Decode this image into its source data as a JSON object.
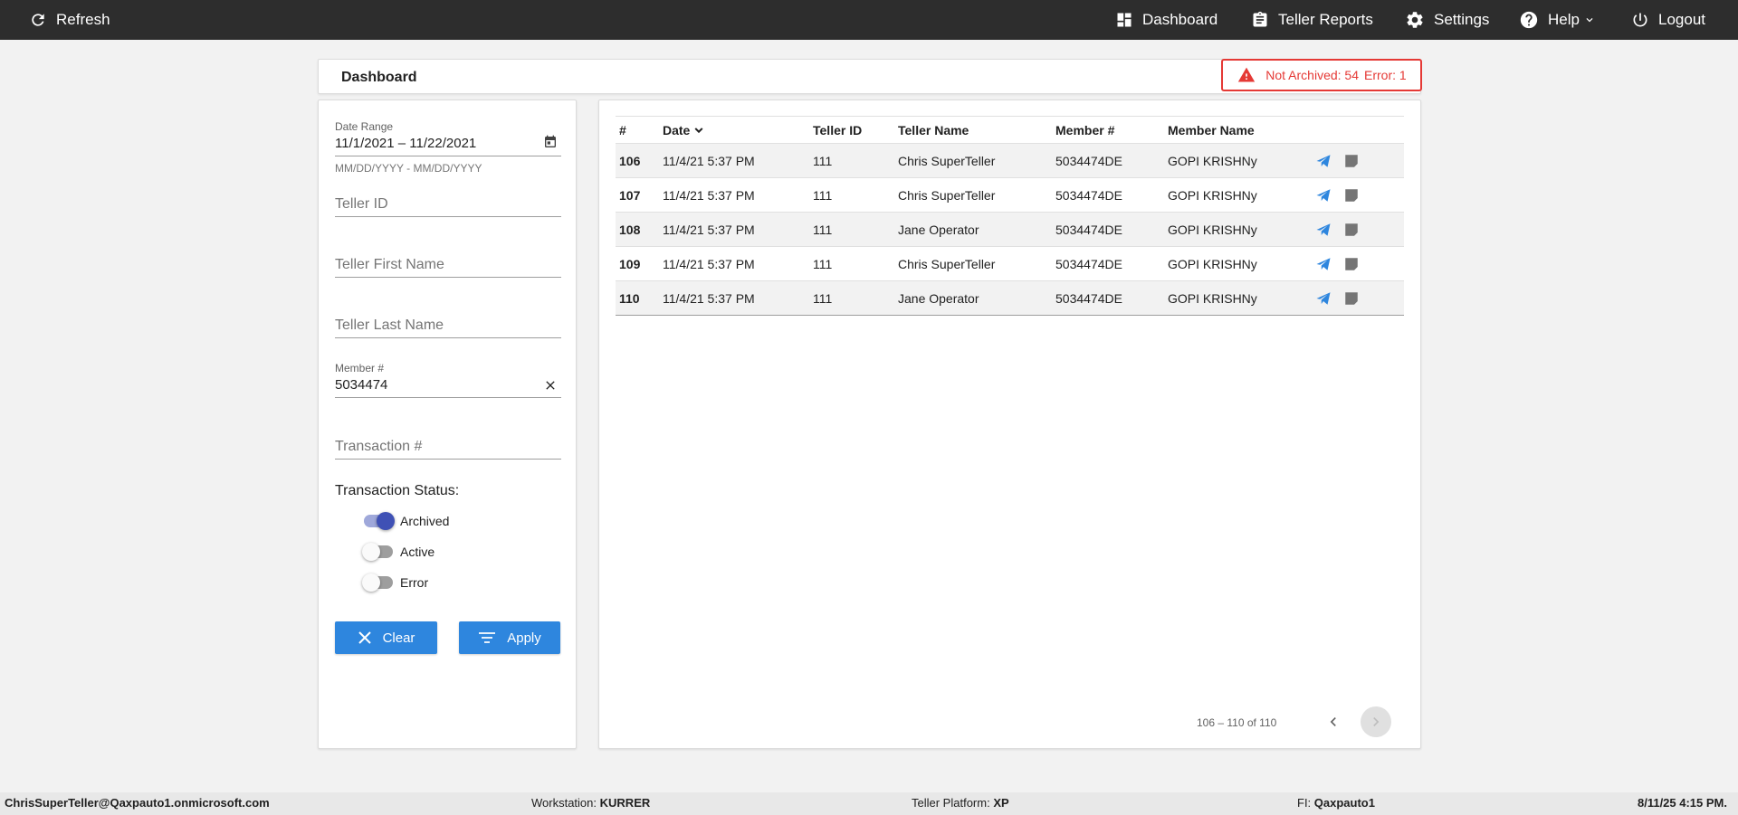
{
  "topbar": {
    "refresh_label": "Refresh",
    "nav": [
      {
        "label": "Dashboard",
        "icon": "dashboard-icon"
      },
      {
        "label": "Teller Reports",
        "icon": "clipboard-icon"
      },
      {
        "label": "Settings",
        "icon": "gear-icon"
      },
      {
        "label": "Help",
        "icon": "help-icon"
      },
      {
        "label": "Logout",
        "icon": "power-icon"
      }
    ]
  },
  "header": {
    "title": "Dashboard",
    "alert": {
      "not_archived_label": "Not Archived: 54",
      "error_label": "Error: 1",
      "color": "#e53935"
    }
  },
  "filters": {
    "date_range": {
      "label": "Date Range",
      "value": "11/1/2021 – 11/22/2021",
      "hint": "MM/DD/YYYY - MM/DD/YYYY"
    },
    "teller_id": {
      "placeholder": "Teller ID",
      "value": ""
    },
    "teller_first_name": {
      "placeholder": "Teller First Name",
      "value": ""
    },
    "teller_last_name": {
      "placeholder": "Teller Last Name",
      "value": ""
    },
    "member_num": {
      "label": "Member #",
      "value": "5034474"
    },
    "transaction_num": {
      "placeholder": "Transaction #",
      "value": ""
    },
    "status_title": "Transaction Status:",
    "statuses": [
      {
        "label": "Archived",
        "checked": true
      },
      {
        "label": "Active",
        "checked": false
      },
      {
        "label": "Error",
        "checked": false
      }
    ],
    "clear_label": "Clear",
    "apply_label": "Apply",
    "button_color": "#2e86de"
  },
  "table": {
    "columns": [
      "#",
      "Date",
      "Teller ID",
      "Teller Name",
      "Member #",
      "Member Name"
    ],
    "rows": [
      {
        "num": "106",
        "date": "11/4/21 5:37 PM",
        "teller_id": "111",
        "teller_name": "Chris SuperTeller",
        "member_num": "5034474DE",
        "member_name": "GOPI KRISHNy"
      },
      {
        "num": "107",
        "date": "11/4/21 5:37 PM",
        "teller_id": "111",
        "teller_name": "Chris SuperTeller",
        "member_num": "5034474DE",
        "member_name": "GOPI KRISHNy"
      },
      {
        "num": "108",
        "date": "11/4/21 5:37 PM",
        "teller_id": "111",
        "teller_name": "Jane Operator",
        "member_num": "5034474DE",
        "member_name": "GOPI KRISHNy"
      },
      {
        "num": "109",
        "date": "11/4/21 5:37 PM",
        "teller_id": "111",
        "teller_name": "Chris SuperTeller",
        "member_num": "5034474DE",
        "member_name": "GOPI KRISHNy"
      },
      {
        "num": "110",
        "date": "11/4/21 5:37 PM",
        "teller_id": "111",
        "teller_name": "Jane Operator",
        "member_num": "5034474DE",
        "member_name": "GOPI KRISHNy"
      }
    ],
    "pagination": "106 – 110 of 110"
  },
  "footer": {
    "user": "ChrisSuperTeller@Qaxpauto1.onmicrosoft.com",
    "workstation_label": "Workstation:",
    "workstation_value": "KURRER",
    "platform_label": "Teller Platform:",
    "platform_value": "XP",
    "fi_label": "FI:",
    "fi_value": "Qaxpauto1",
    "datetime": "8/11/25 4:15 PM."
  }
}
